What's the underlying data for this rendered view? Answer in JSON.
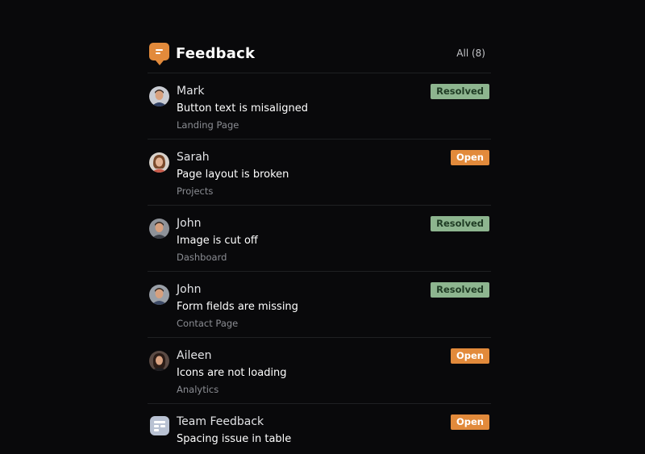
{
  "header": {
    "title": "Feedback",
    "all_label": "All (8)"
  },
  "colors": {
    "accent": "#e28a3b",
    "resolved": "#8db58f",
    "background": "#09090b"
  },
  "items": [
    {
      "name": "Mark",
      "summary": "Button text is misaligned",
      "page": "Landing Page",
      "status": "Resolved",
      "avatar": "person-avatar"
    },
    {
      "name": "Sarah",
      "summary": "Page layout is broken",
      "page": "Projects",
      "status": "Open",
      "avatar": "person-avatar"
    },
    {
      "name": "John",
      "summary": "Image is cut off",
      "page": "Dashboard",
      "status": "Resolved",
      "avatar": "person-avatar"
    },
    {
      "name": "John",
      "summary": "Form fields are missing",
      "page": "Contact Page",
      "status": "Resolved",
      "avatar": "person-avatar"
    },
    {
      "name": "Aileen",
      "summary": "Icons are not loading",
      "page": "Analytics",
      "status": "Open",
      "avatar": "person-avatar"
    },
    {
      "name": "Team Feedback",
      "summary": "Spacing issue in table",
      "page": "",
      "status": "Open",
      "avatar": "team-icon"
    }
  ]
}
